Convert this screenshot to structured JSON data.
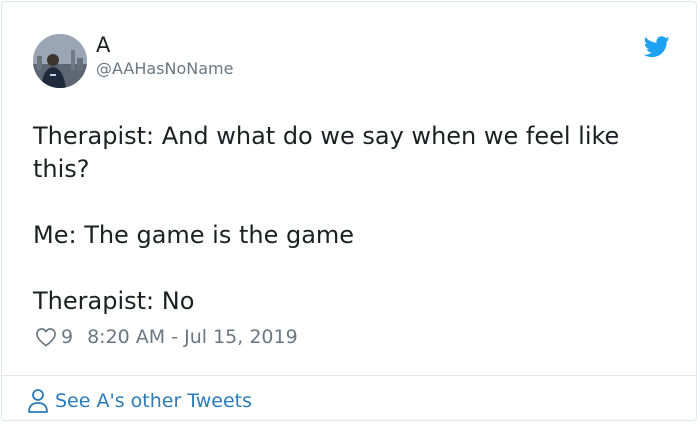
{
  "tweet": {
    "author_name": "A",
    "author_handle": "@AAHasNoName",
    "text_paragraphs": [
      "Therapist: And what do we say when we feel like this?",
      "Me: The game is the game",
      "Therapist: No"
    ],
    "like_count": "9",
    "timestamp": "8:20 AM - Jul 15, 2019"
  },
  "footer": {
    "see_other_label": "See A's other Tweets"
  },
  "icons": {
    "brand": "twitter-bird-icon",
    "like": "heart-icon",
    "profile": "person-icon"
  },
  "colors": {
    "brand_blue": "#1da1f2",
    "link_blue": "#2b7bb9",
    "muted_gray": "#697882",
    "text": "#1c2022",
    "border": "#e1e8ed"
  }
}
